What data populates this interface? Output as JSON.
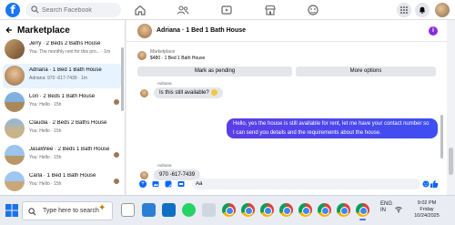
{
  "topbar": {
    "logo": "f",
    "search_placeholder": "Search Facebook",
    "nav_icons": [
      "home-icon",
      "friends-icon",
      "video-icon",
      "marketplace-icon",
      "gaming-icon"
    ],
    "right_icons": [
      "menu-grid-icon",
      "messenger-icon",
      "notifications-bell-icon",
      "profile-avatar"
    ]
  },
  "sidebar": {
    "title": "Marketplace",
    "conversations": [
      {
        "name": "Jerry · 2 Beds 2 Baths House",
        "preview": "You: The monthly rent for this pro... · 1m",
        "active": false
      },
      {
        "name": "Adriana · 1 Bed 1 Bath House",
        "preview": "Adriana: 970 -617-7439 · 1m",
        "active": true
      },
      {
        "name": "Lori · 2 Beds 1 Bath House",
        "preview": "You: Hello · 15h",
        "active": false
      },
      {
        "name": "Claudia · 2 Beds 2 Baths House",
        "preview": "You: Hello · 15h",
        "active": false
      },
      {
        "name": "JasaWlee · 2 Beds 1 Bath House",
        "preview": "You: Hello · 15h",
        "active": false
      },
      {
        "name": "Carla · 1 Bed 1 Bath House",
        "preview": "You: Hello · 15h",
        "active": false
      }
    ]
  },
  "chat": {
    "header_title": "Adriana · 1 Bed 1 Bath House",
    "listing_label": "Marketplace",
    "listing_price": "$480 · 1 Bed 1 Bath House",
    "mark_pending_label": "Mark as pending",
    "more_options_label": "More options",
    "messages": {
      "sender_top": "Adriana",
      "in_1": "Is this still available?",
      "out_1": "Hello, yes the house is still available for rent, let me have your contact number so I can send you details and the requirements about the house.",
      "sender_bottom": "Adriana",
      "in_2": "970 -617-7439"
    },
    "composer_value": "Aa"
  },
  "taskbar": {
    "search_text": "Type here to search",
    "apps": [
      "Chrome",
      "Chrome",
      "Chrome",
      "Chrome",
      "Chrome",
      "Chrome",
      "Chrome",
      "Chrome",
      "Chrome",
      "Chrome",
      "Chrome",
      "Chrome"
    ],
    "tray": {
      "language": "ENG",
      "region": "IN",
      "time": "9:02 PM",
      "day": "Friday",
      "date": "10/24/2025"
    }
  },
  "colors": {
    "facebook_blue": "#1877f2",
    "outgoing_bubble": "#4a3cf0",
    "active_row": "#e7f3ff"
  }
}
